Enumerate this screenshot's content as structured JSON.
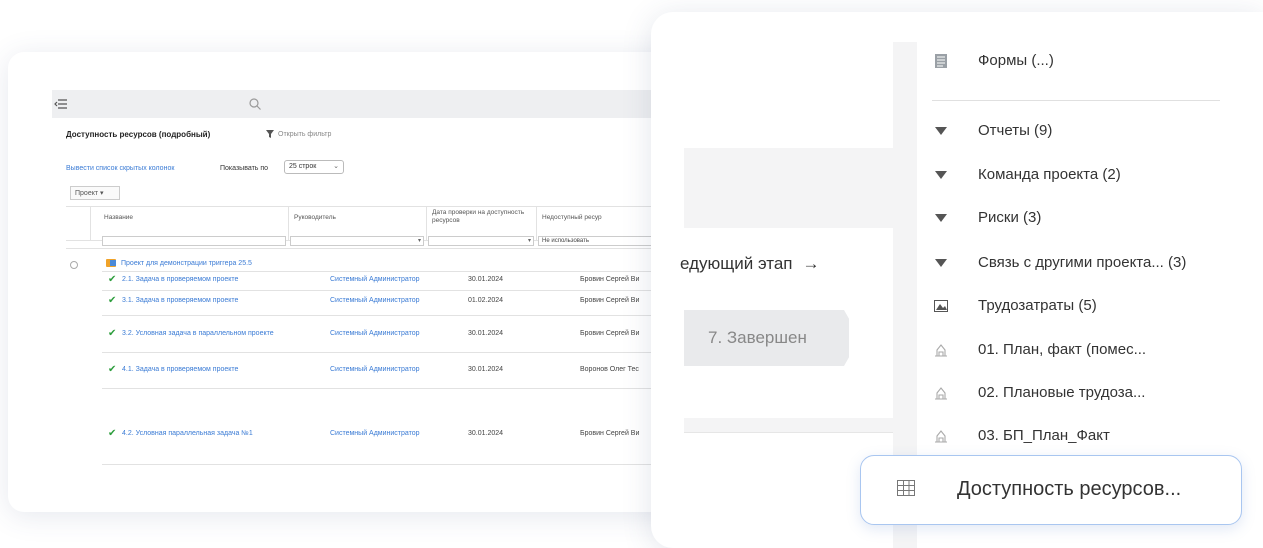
{
  "left_panel": {
    "report_title": "Доступность ресурсов (подробный)",
    "filter_label": "Открыть фильтр",
    "hidden_columns_link": "Вывести список скрытых колонок",
    "rows_label": "Показывать по",
    "rows_value": "25 строк",
    "group_button": "Проект",
    "columns": [
      "Название",
      "Руководитель",
      "Дата проверки на доступность ресурсов",
      "Недоступный ресур"
    ],
    "filter_value_last": "Не использовать",
    "group_row": "Проект для демонстрации триггера 25.5",
    "rows": [
      {
        "task": "2.1. Задача в проверяемом проекте",
        "manager": "Системный Администратор",
        "date": "30.01.2024",
        "resource": "Бровин Сергей Ви"
      },
      {
        "task": "3.1. Задача в проверяемом проекте",
        "manager": "Системный Администратор",
        "date": "01.02.2024",
        "resource": "Бровин Сергей Ви"
      },
      {
        "task": "3.2. Условная задача в параллельном проекте",
        "manager": "Системный Администратор",
        "date": "30.01.2024",
        "resource": "Бровин Сергей Ви"
      },
      {
        "task": "4.1. Задача в проверяемом проекте",
        "manager": "Системный Администратор",
        "date": "30.01.2024",
        "resource": "Воронов Олег Тес"
      },
      {
        "task": "4.2. Условная параллельная задача №1",
        "manager": "Системный Администратор",
        "date": "30.01.2024",
        "resource": "Бровин Сергей Ви"
      }
    ]
  },
  "right_panel": {
    "next_step": "едующий этап",
    "stage": "7. Завершен",
    "menu": [
      {
        "label": "Формы (...)",
        "icon": "form-icon"
      },
      {
        "label": "Отчеты (9)",
        "icon": "triangle-down-icon"
      },
      {
        "label": "Команда проекта (2)",
        "icon": "triangle-down-icon"
      },
      {
        "label": "Риски (3)",
        "icon": "triangle-down-icon"
      },
      {
        "label": "Связь с другими проекта... (3)",
        "icon": "triangle-down-icon"
      },
      {
        "label": "Трудозатраты (5)",
        "icon": "image-icon"
      },
      {
        "label": "01. План, факт (помес...",
        "icon": "report-icon"
      },
      {
        "label": "02. Плановые трудоза...",
        "icon": "report-icon"
      },
      {
        "label": "03. БП_План_Факт",
        "icon": "report-icon"
      }
    ],
    "highlighted_item": "Доступность ресурсов..."
  }
}
